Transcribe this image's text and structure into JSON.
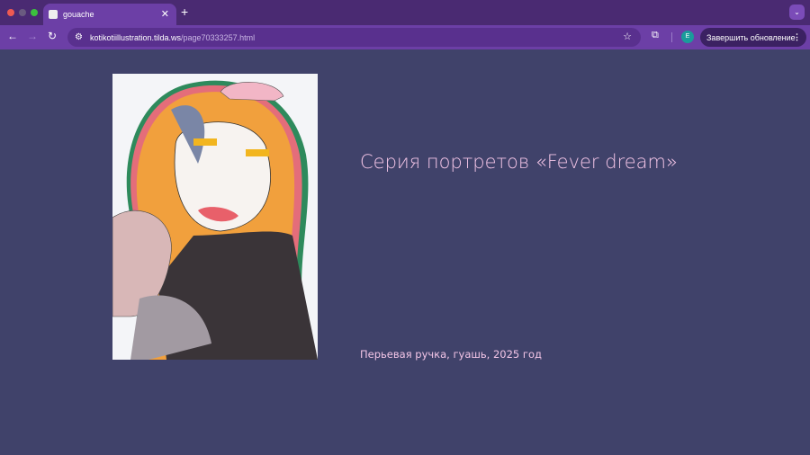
{
  "browser": {
    "tab_title": "gouache",
    "url_host": "kotikotiillustration.tilda.ws",
    "url_path": "/page70333257.html",
    "profile_initial": "E",
    "update_button": "Завершить обновление"
  },
  "page": {
    "title": "Серия портретов «Fever dream»",
    "caption": "Перьевая ручка, гуашь, 2025 год"
  }
}
